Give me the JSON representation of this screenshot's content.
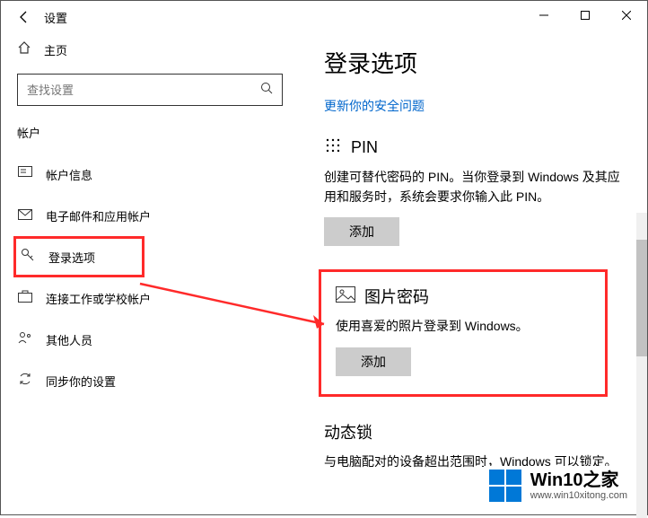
{
  "titlebar": {
    "title": "设置"
  },
  "sidebar": {
    "home_label": "主页",
    "search_placeholder": "查找设置",
    "section_label": "帐户",
    "items": [
      {
        "label": "帐户信息"
      },
      {
        "label": "电子邮件和应用帐户"
      },
      {
        "label": "登录选项"
      },
      {
        "label": "连接工作或学校帐户"
      },
      {
        "label": "其他人员"
      },
      {
        "label": "同步你的设置"
      }
    ]
  },
  "content": {
    "heading": "登录选项",
    "link_text": "更新你的安全问题",
    "pin": {
      "title": "PIN",
      "desc": "创建可替代密码的 PIN。当你登录到 Windows 及其应用和服务时，系统会要求你输入此 PIN。",
      "button": "添加"
    },
    "picture": {
      "title": "图片密码",
      "desc": "使用喜爱的照片登录到 Windows。",
      "button": "添加"
    },
    "dynamic": {
      "title": "动态锁",
      "desc": "与电脑配对的设备超出范围时，Windows 可以锁定。"
    }
  },
  "watermark": {
    "text": "Win10之家",
    "url": "www.win10xitong.com"
  }
}
